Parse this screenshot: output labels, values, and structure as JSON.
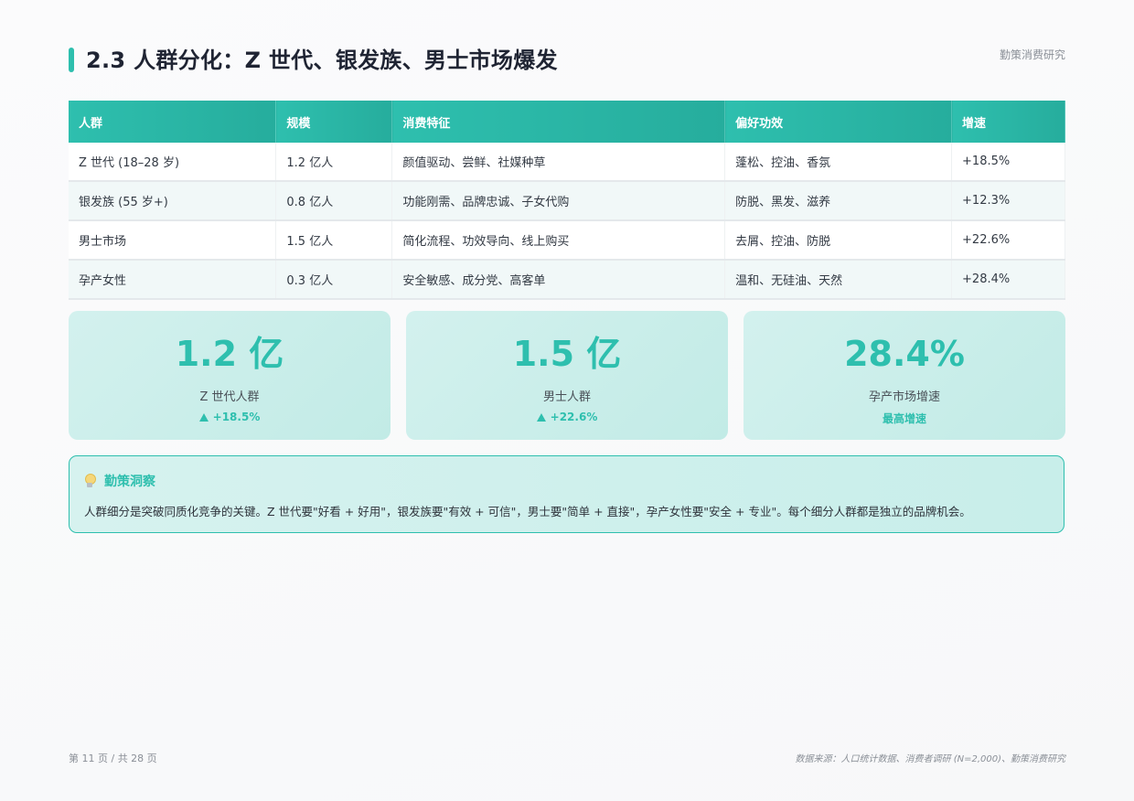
{
  "header": {
    "title": "2.3 人群分化：Z 世代、银发族、男士市场爆发",
    "brand": "勤策消费研究"
  },
  "table": {
    "columns": [
      "人群",
      "规模",
      "消费特征",
      "偏好功效",
      "增速"
    ],
    "rows": [
      [
        "Z 世代 (18–28 岁)",
        "1.2 亿人",
        "颜值驱动、尝鲜、社媒种草",
        "蓬松、控油、香氛",
        "+18.5%"
      ],
      [
        "银发族 (55 岁+)",
        "0.8 亿人",
        "功能刚需、品牌忠诚、子女代购",
        "防脱、黑发、滋养",
        "+12.3%"
      ],
      [
        "男士市场",
        "1.5 亿人",
        "简化流程、功效导向、线上购买",
        "去屑、控油、防脱",
        "+22.6%"
      ],
      [
        "孕产女性",
        "0.3 亿人",
        "安全敏感、成分党、高客单",
        "温和、无硅油、天然",
        "+28.4%"
      ]
    ]
  },
  "cards": [
    {
      "value": "1.2 亿",
      "label": "Z 世代人群",
      "delta": "+18.5%",
      "show_arrow": true
    },
    {
      "value": "1.5 亿",
      "label": "男士人群",
      "delta": "+22.6%",
      "show_arrow": true
    },
    {
      "value": "28.4%",
      "label": "孕产市场增速",
      "delta": "最高增速",
      "show_arrow": false
    }
  ],
  "insight": {
    "icon": "lightbulb-icon",
    "title": "勤策洞察",
    "body": "人群细分是突破同质化竞争的关键。Z 世代要\"好看 + 好用\"，银发族要\"有效 + 可信\"，男士要\"简单 + 直接\"，孕产女性要\"安全 + 专业\"。每个细分人群都是独立的品牌机会。"
  },
  "footer": {
    "page": "第 11 页 / 共 28 页",
    "source": "数据来源：人口统计数据、消费者调研 (N=2,000)、勤策消费研究"
  },
  "colors": {
    "accent": "#2ebfae",
    "card_bg": "#c8eeea",
    "title_text": "#1f2433"
  }
}
